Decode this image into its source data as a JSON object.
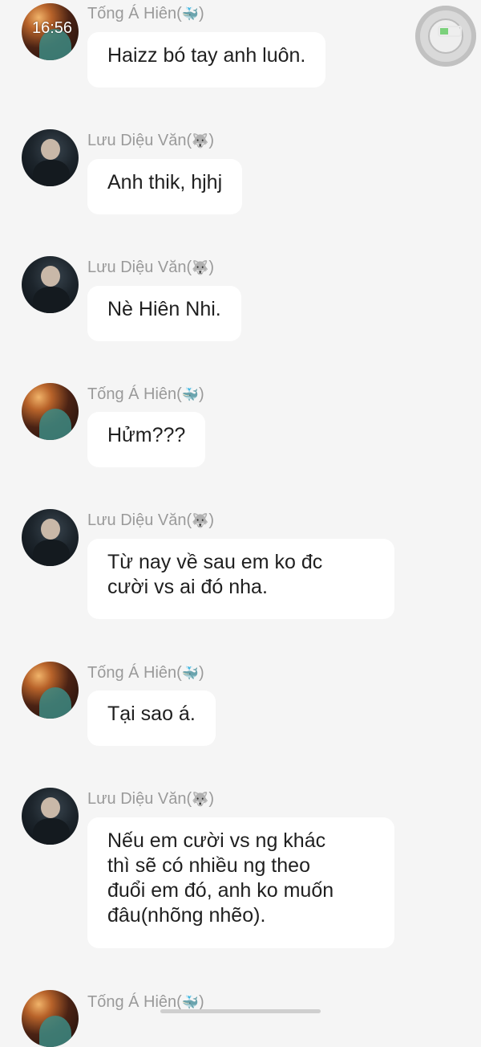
{
  "status_bar": {
    "time": "16:56"
  },
  "messages": [
    {
      "sender": "Tống Á Hiên(",
      "sender_emoji": "🐳",
      "sender_end": ")",
      "avatar": "hien",
      "text": "Haizz bó tay anh luôn."
    },
    {
      "sender": "Lưu Diệu Văn(",
      "sender_emoji": "🐺",
      "sender_end": ")",
      "avatar": "van",
      "text": "Anh thik, hjhj"
    },
    {
      "sender": "Lưu Diệu Văn(",
      "sender_emoji": "🐺",
      "sender_end": ")",
      "avatar": "van",
      "text": "Nè Hiên Nhi."
    },
    {
      "sender": "Tống Á Hiên(",
      "sender_emoji": "🐳",
      "sender_end": ")",
      "avatar": "hien",
      "text": "Hửm???"
    },
    {
      "sender": "Lưu Diệu Văn(",
      "sender_emoji": "🐺",
      "sender_end": ")",
      "avatar": "van",
      "text_lines": [
        "Từ nay về sau em ko đc",
        "cười vs ai đó nha."
      ]
    },
    {
      "sender": "Tống Á Hiên(",
      "sender_emoji": "🐳",
      "sender_end": ")",
      "avatar": "hien",
      "text": "Tại sao á."
    },
    {
      "sender": "Lưu Diệu Văn(",
      "sender_emoji": "🐺",
      "sender_end": ")",
      "avatar": "van",
      "text_lines": [
        "Nếu em cười vs ng khác",
        "thì sẽ có nhiều ng theo",
        "đuổi em đó, anh ko muốn",
        "đâu(nhõng nhẽo)."
      ]
    },
    {
      "sender": "Tống Á Hiên(",
      "sender_emoji": "🐳",
      "sender_end": ")",
      "avatar": "hien"
    }
  ]
}
